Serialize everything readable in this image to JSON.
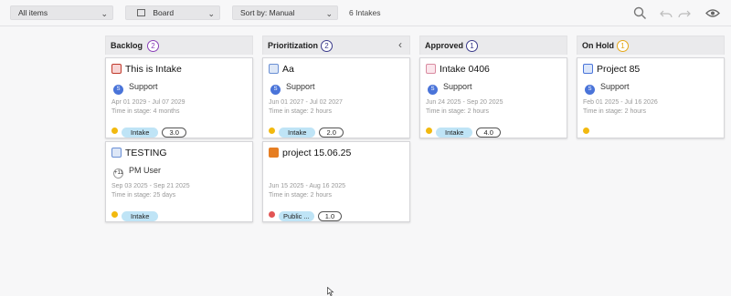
{
  "toolbar": {
    "filter": "All items",
    "view": "Board",
    "sort": "Sort by: Manual",
    "count": "6 Intakes"
  },
  "icons": {
    "search": "search-icon",
    "undo": "undo-icon",
    "redo": "redo-icon",
    "visibility": "eye-icon",
    "collapse": "chevron-left-icon"
  },
  "colors": {
    "tag_bg": "#bfe4f6",
    "dot_yellow": "#f2b90f",
    "dot_red": "#e25555",
    "avatar_blue": "#4a74d9"
  },
  "columns": [
    {
      "title": "Backlog",
      "count": "2",
      "badge_color": "#8a3fb8"
    },
    {
      "title": "Prioritization",
      "count": "2",
      "badge_color": "#3a3a8a"
    },
    {
      "title": "Approved",
      "count": "1",
      "badge_color": "#3a3a8a"
    },
    {
      "title": "On Hold",
      "count": "1",
      "badge_color": "#e6a817"
    }
  ],
  "cards": [
    {
      "title": "This is Intake",
      "user": "Support",
      "user_initial": "S",
      "dates": "Apr 01 2029 - Jul 07 2029",
      "stage": "Time in stage: 4 months",
      "tag": "Intake",
      "number": "3.0",
      "dot_color": "#f2b90f",
      "icon_color": "#c0392b"
    },
    {
      "title": "TESTING",
      "user": "PM User",
      "user_initial": "+11",
      "dates": "Sep 03 2025 - Sep 21 2025",
      "stage": "Time in stage: 25 days",
      "tag": "Intake",
      "number": "",
      "dot_color": "#f2b90f",
      "icon_color": "#6a8fd4"
    },
    {
      "title": "Aa",
      "user": "Support",
      "user_initial": "S",
      "dates": "Jun 01 2027 - Jul 02 2027",
      "stage": "Time in stage: 2 hours",
      "tag": "Intake",
      "number": "2.0",
      "dot_color": "#f2b90f",
      "icon_color": "#6a8fd4"
    },
    {
      "title": "project 15.06.25",
      "user": "",
      "user_initial": "",
      "dates": "Jun 15 2025 - Aug 16 2025",
      "stage": "Time in stage: 2 hours",
      "tag": "Public ...",
      "number": "1.0",
      "dot_color": "#e25555",
      "icon_color": "#e67e22"
    },
    {
      "title": "Intake 0406",
      "user": "Support",
      "user_initial": "S",
      "dates": "Jun 24 2025 - Sep 20 2025",
      "stage": "Time in stage: 2 hours",
      "tag": "Intake",
      "number": "4.0",
      "dot_color": "#f2b90f",
      "icon_color": "#d98ba0"
    },
    {
      "title": "Project 85",
      "user": "Support",
      "user_initial": "S",
      "dates": "Feb 01 2025 - Jul 16 2026",
      "stage": "Time in stage: 2 hours",
      "tag": "",
      "number": "",
      "dot_color": "#f2b90f",
      "icon_color": "#4a74d9"
    }
  ]
}
